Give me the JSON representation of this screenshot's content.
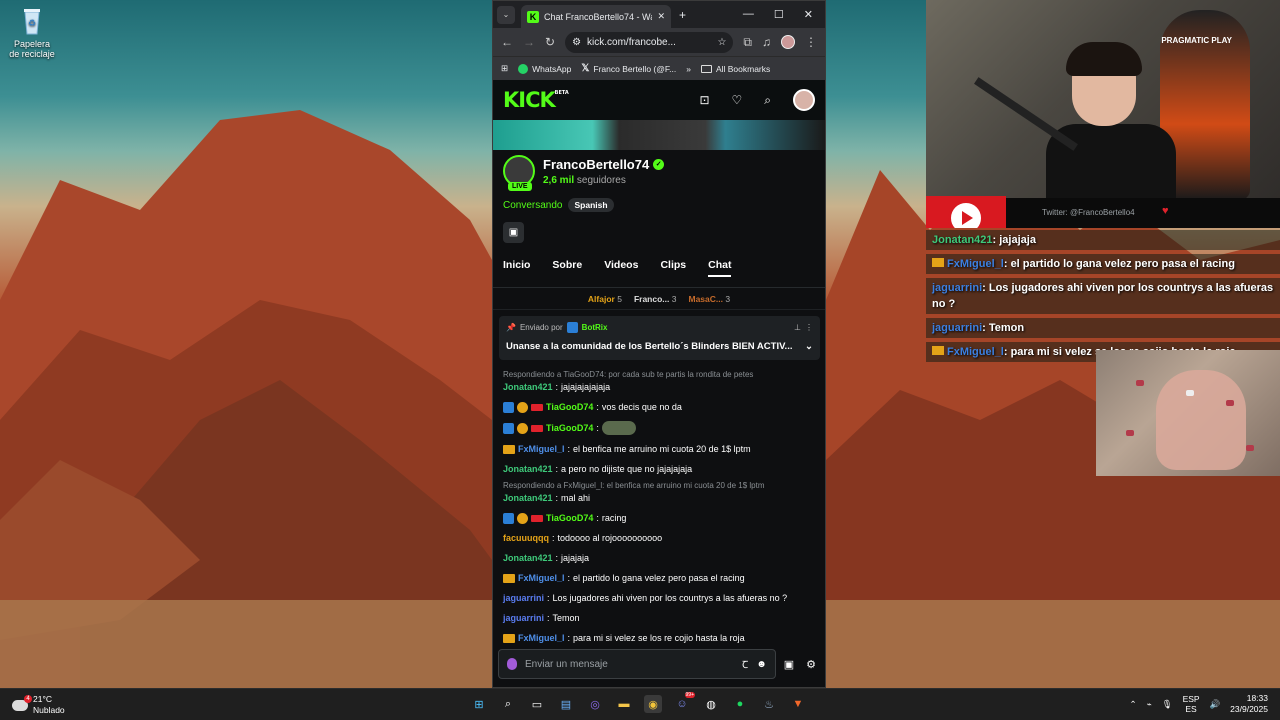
{
  "desktop": {
    "recycle_label": "Papelera de reciclaje"
  },
  "browser": {
    "tab_title": "Chat FrancoBertello74 - Watch",
    "url": "kick.com/francobe...",
    "bookmarks": [
      "WhatsApp",
      "Franco Bertello (@F...",
      "All Bookmarks"
    ]
  },
  "kick": {
    "logo": "KICK",
    "logo_sup": "BETA",
    "channel_name": "FrancoBertello74",
    "followers_count": "2,6 mil",
    "followers_label": "seguidores",
    "live_label": "LIVE",
    "category": "Conversando",
    "language": "Spanish",
    "tabs": [
      "Inicio",
      "Sobre",
      "Videos",
      "Clips",
      "Chat"
    ],
    "leaderboard": [
      {
        "name": "Alfajor",
        "count": "5"
      },
      {
        "name": "Franco...",
        "count": "3"
      },
      {
        "name": "MasaC...",
        "count": "3"
      }
    ],
    "pinned": {
      "sent_by": "Enviado por",
      "author": "BotRix",
      "message": "Unanse a la comunidad de los Bertello´s Blinders BIEN ACTIV..."
    },
    "chat_input_placeholder": "Enviar un mensaje"
  },
  "chat_messages": [
    {
      "reply": "Respondiendo a TiaGooD74: por cada sub te partis la rondita de petes",
      "user": "Jonatan421",
      "color": "#3ec97a",
      "text": "jajajajajajaja",
      "badges": []
    },
    {
      "reply": "",
      "user": "TiaGooD74",
      "color": "#53fc18",
      "text": "vos decis que no da",
      "badges": [
        "blue",
        "sub",
        "red"
      ]
    },
    {
      "reply": "",
      "user": "TiaGooD74",
      "color": "#53fc18",
      "text": "",
      "emote": true,
      "badges": [
        "blue",
        "sub",
        "red"
      ]
    },
    {
      "reply": "",
      "user": "FxMiguel_l",
      "color": "#4f8fe8",
      "text": "el benfica me arruino mi cuota 20 de 1$ lptm",
      "badges": [
        "crown"
      ]
    },
    {
      "reply": "",
      "user": "Jonatan421",
      "color": "#3ec97a",
      "text": "a pero no dijiste que no jajajajaja",
      "badges": []
    },
    {
      "reply": "Respondiendo a FxMiguel_l: el benfica me arruino mi cuota 20 de 1$ lptm",
      "user": "Jonatan421",
      "color": "#3ec97a",
      "text": "mal ahi",
      "badges": []
    },
    {
      "reply": "",
      "user": "TiaGooD74",
      "color": "#53fc18",
      "text": "racing",
      "badges": [
        "blue",
        "sub",
        "red"
      ]
    },
    {
      "reply": "",
      "user": "facuuuqqq",
      "color": "#e4a318",
      "text": "todoooo al rojoooooooooo",
      "badges": []
    },
    {
      "reply": "",
      "user": "Jonatan421",
      "color": "#3ec97a",
      "text": "jajajaja",
      "badges": []
    },
    {
      "reply": "",
      "user": "FxMiguel_l",
      "color": "#4f8fe8",
      "text": "el partido lo gana velez pero pasa el racing",
      "badges": [
        "crown"
      ]
    },
    {
      "reply": "",
      "user": "jaguarrini",
      "color": "#5a7cf0",
      "text": "Los jugadores ahi viven por los countrys a las afueras no ?",
      "badges": []
    },
    {
      "reply": "",
      "user": "jaguarrini",
      "color": "#5a7cf0",
      "text": "Temon",
      "badges": []
    },
    {
      "reply": "",
      "user": "FxMiguel_l",
      "color": "#4f8fe8",
      "text": "para mi si velez se los re cojio hasta la roja",
      "badges": [
        "crown"
      ]
    }
  ],
  "stream": {
    "chair_brand": "PRAGMATIC PLAY",
    "twitter": "Twitter: @FrancoBertello4"
  },
  "overlay_chat": [
    {
      "user": "Jonatan421",
      "text": ": jajajaja",
      "crown": false,
      "color": "green"
    },
    {
      "user": "FxMiguel_l",
      "text": ": el partido lo gana velez pero pasa el racing",
      "crown": true,
      "color": "blue"
    },
    {
      "user": "jaguarrini",
      "text": ": Los jugadores ahi viven por los countrys a las afueras no ?",
      "crown": false,
      "color": "blue"
    },
    {
      "user": "jaguarrini",
      "text": ": Temon",
      "crown": false,
      "color": "blue"
    },
    {
      "user": "FxMiguel_l",
      "text": ": para mi si velez se los re cojio hasta la roja",
      "crown": true,
      "color": "blue"
    }
  ],
  "taskbar": {
    "temperature": "21°C",
    "weather": "Nublado",
    "weather_badge": "4",
    "lang_top": "ESP",
    "lang_bottom": "ES",
    "time": "18:33",
    "date": "23/9/2025",
    "discord_badge": "99+"
  }
}
